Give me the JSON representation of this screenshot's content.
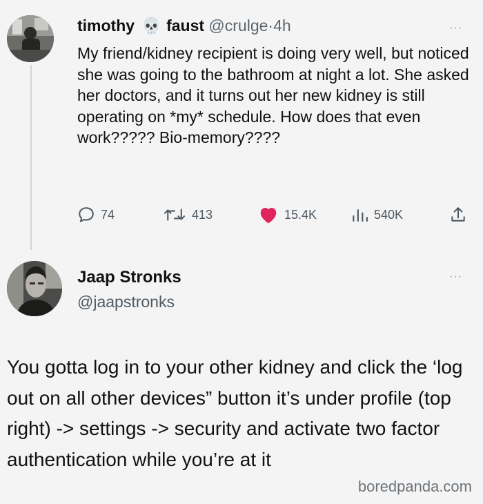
{
  "tweet": {
    "author_first": "timothy",
    "author_emoji": "💀",
    "author_last": "faust",
    "handle": "@crulge",
    "separator": "·",
    "time": "4h",
    "text": "My friend/kidney recipient is doing very well, but noticed she was going to the bathroom at night a lot. She asked her doctors, and it turns out her new kidney is still operating on *my* schedule. How does that even work????? Bio-memory????",
    "stats": {
      "replies": "74",
      "retweets": "413",
      "likes": "15.4K",
      "views": "540K"
    },
    "more_label": "···"
  },
  "reply": {
    "name": "Jaap Stronks",
    "handle": "@jaapstronks",
    "more_label": "···",
    "text": "You gotta log in to your other kidney and click the ‘log out on all other devices” button it’s under profile (top right) -> settings -> security and activate two factor authentication while you’re at it"
  },
  "watermark": "boredpanda.com",
  "colors": {
    "like_heart": "#e0245e",
    "text": "#111111",
    "secondary": "#4e5962",
    "thread_line": "#cfd4d8"
  },
  "icons": [
    "reply-icon",
    "retweet-icon",
    "heart-icon",
    "views-icon",
    "share-icon",
    "more-icon"
  ]
}
